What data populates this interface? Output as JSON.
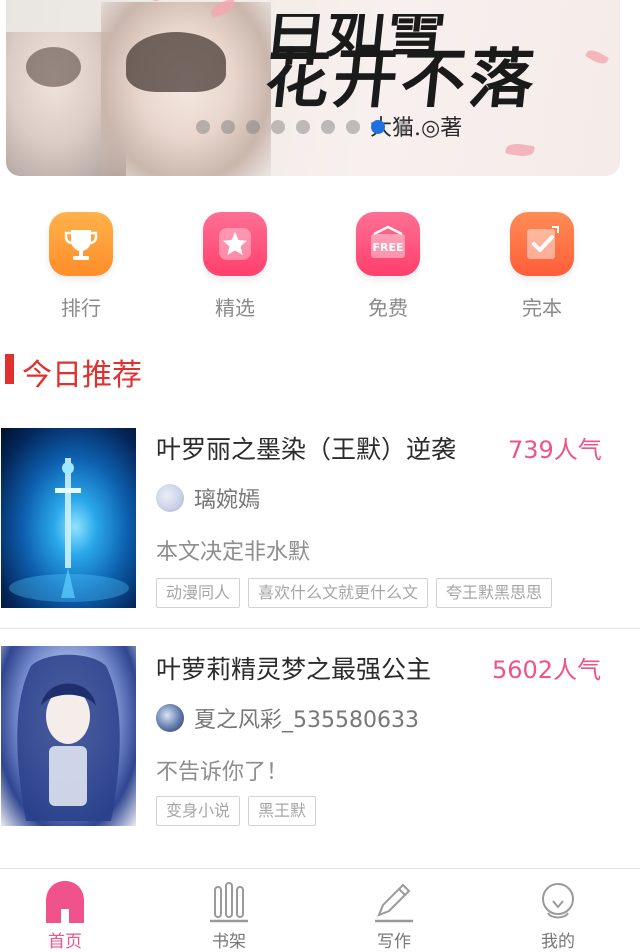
{
  "banner": {
    "title_top": "白如雪",
    "title_main": "花开不落",
    "author": "大猫.◎著",
    "dot_count": 9,
    "active_dot": 7
  },
  "categories": [
    {
      "label": "排行",
      "icon": "trophy-icon"
    },
    {
      "label": "精选",
      "icon": "star-icon"
    },
    {
      "label": "免费",
      "icon": "free-icon"
    },
    {
      "label": "完本",
      "icon": "checkbox-icon"
    }
  ],
  "section": {
    "title": "今日推荐"
  },
  "books": [
    {
      "title": "叶罗丽之墨染（王默）逆袭",
      "popularity": "739人气",
      "author": "璃婉嫣",
      "description": "本文决定非水默",
      "tags": [
        "动漫同人",
        "喜欢什么文就更什么文",
        "夸王默黑思思"
      ]
    },
    {
      "title": "叶萝莉精灵梦之最强公主",
      "popularity": "5602人气",
      "author": "夏之风彩_535580633",
      "description": "不告诉你了！",
      "tags": [
        "变身小说",
        "黑王默"
      ]
    }
  ],
  "nav": [
    {
      "label": "首页",
      "icon": "home-icon",
      "active": true
    },
    {
      "label": "书架",
      "icon": "bookshelf-icon",
      "active": false
    },
    {
      "label": "写作",
      "icon": "pen-icon",
      "active": false
    },
    {
      "label": "我的",
      "icon": "profile-icon",
      "active": false
    }
  ],
  "colors": {
    "accent": "#f0528b",
    "section": "#e2302f",
    "dot_active": "#1f6fe0"
  }
}
